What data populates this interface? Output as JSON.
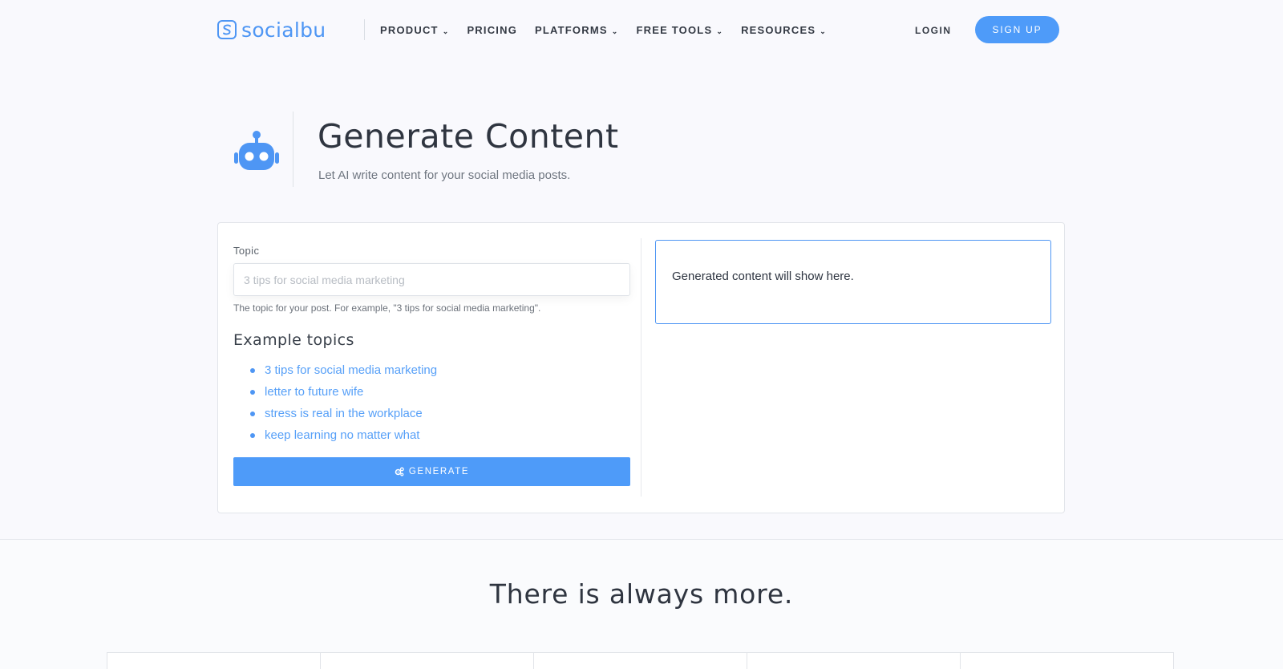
{
  "brand": {
    "name": "socialbu",
    "accent": "#4e9bf9"
  },
  "nav": {
    "items": [
      {
        "label": "PRODUCT",
        "has_dropdown": true
      },
      {
        "label": "PRICING",
        "has_dropdown": false
      },
      {
        "label": "PLATFORMS",
        "has_dropdown": true
      },
      {
        "label": "FREE TOOLS",
        "has_dropdown": true
      },
      {
        "label": "RESOURCES",
        "has_dropdown": true
      }
    ],
    "login": "LOGIN",
    "signup": "SIGN UP",
    "caret": "⌄"
  },
  "header": {
    "icon": "robot-icon",
    "title": "Generate Content",
    "subtitle": "Let AI write content for your social media posts."
  },
  "form": {
    "topic_label": "Topic",
    "topic_placeholder": "3 tips for social media marketing",
    "topic_value": "",
    "help": "The topic for your post. For example, \"3 tips for social media marketing\".",
    "examples_title": "Example topics",
    "examples": [
      "3 tips for social media marketing",
      "letter to future wife",
      "stress is real in the workplace",
      "keep learning no matter what"
    ],
    "generate_label": "GENERATE",
    "generate_icon": "cogs-icon"
  },
  "output": {
    "placeholder_text": "Generated content will show here."
  },
  "more": {
    "title": "There is always more."
  }
}
